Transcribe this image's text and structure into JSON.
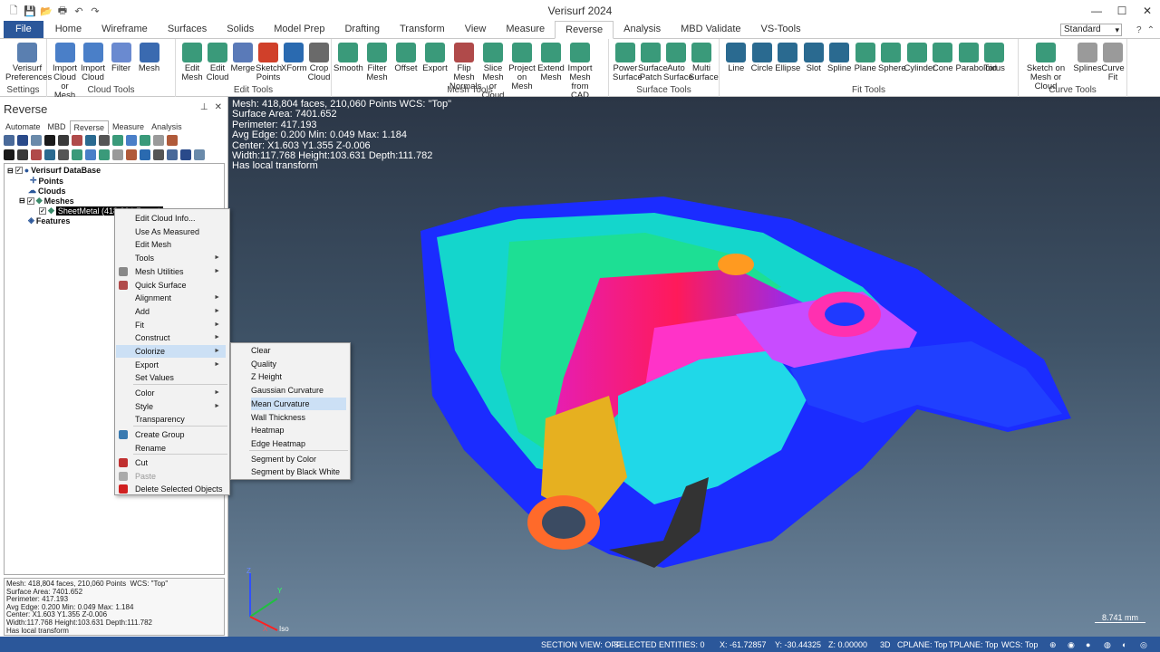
{
  "window": {
    "title": "Verisurf 2024"
  },
  "ribbon_tabs": [
    "File",
    "Home",
    "Wireframe",
    "Surfaces",
    "Solids",
    "Model Prep",
    "Drafting",
    "Transform",
    "View",
    "Measure",
    "Reverse",
    "Analysis",
    "MBD Validate",
    "VS-Tools"
  ],
  "active_tab": "Reverse",
  "style_select": "Standard",
  "groups": {
    "settings": {
      "label": "Settings",
      "buttons": [
        "Verisurf\nPreferences"
      ]
    },
    "cloud": {
      "label": "Cloud Tools",
      "buttons": [
        "Import Cloud\nor Mesh",
        "Import\nCloud",
        "Filter",
        "Mesh"
      ]
    },
    "edit": {
      "label": "Edit Tools",
      "buttons": [
        "Edit\nMesh",
        "Edit\nCloud",
        "Merge",
        "Sketch\nPoints",
        "XForm",
        "Crop\nCloud"
      ]
    },
    "mesh": {
      "label": "Mesh Tools",
      "buttons": [
        "Smooth",
        "Filter\nMesh",
        "Offset",
        "Export",
        "Flip Mesh\nNormals",
        "Slice Mesh\nor Cloud",
        "Project\non Mesh",
        "Extend\nMesh",
        "Import Mesh\nfrom CAD"
      ]
    },
    "surface": {
      "label": "Surface Tools",
      "buttons": [
        "Power\nSurface",
        "Surface\nPatch",
        "Auto\nSurface",
        "Multi\nSurface"
      ]
    },
    "fit": {
      "label": "Fit Tools",
      "buttons": [
        "Line",
        "Circle",
        "Ellipse",
        "Slot",
        "Spline",
        "Plane",
        "Sphere",
        "Cylinder",
        "Cone",
        "Paraboloid",
        "Torus"
      ]
    },
    "curve": {
      "label": "Curve Tools",
      "buttons": [
        "Sketch on\nMesh or Cloud",
        "Splines",
        "Curve\nFit"
      ]
    }
  },
  "panel": {
    "title": "Reverse",
    "tabs": [
      "Automate",
      "MBD",
      "Reverse",
      "Measure",
      "Analysis"
    ],
    "active_tab": "Reverse",
    "tree": {
      "root": "Verisurf DataBase",
      "points": "Points",
      "clouds": "Clouds",
      "meshes": "Meshes",
      "mesh_item": "SheetMetal (418,804 Faces)",
      "features": "Features"
    },
    "info": "Mesh: 418,804 faces, 210,060 Points  WCS: \"Top\"\nSurface Area: 7401.652\nPerimeter: 417.193\nAvg Edge: 0.200 Min: 0.049 Max: 1.184\nCenter: X1.603 Y1.355 Z-0.006\nWidth:117.768 Height:103.631 Depth:111.782\nHas local transform"
  },
  "viewport": {
    "info_lines": [
      "Mesh: 418,804 faces, 210,060 Points  WCS: \"Top\"",
      "Surface Area: 7401.652",
      "Perimeter: 417.193",
      "Avg Edge: 0.200 Min: 0.049 Max: 1.184",
      "Center: X1.603 Y1.355 Z-0.006",
      "Width:117.768 Height:103.631 Depth:111.782",
      "Has local transform"
    ],
    "scale_label": "8.741 mm",
    "axis_labels": {
      "x": "X",
      "y": "Y",
      "z": "Z",
      "iso": "Iso"
    }
  },
  "context_menu": {
    "items": [
      {
        "label": "Edit Cloud Info...",
        "submenu": false
      },
      {
        "label": "Use As Measured",
        "submenu": false
      },
      {
        "label": "Edit Mesh",
        "submenu": false
      },
      {
        "label": "Tools",
        "submenu": true
      },
      {
        "label": "Mesh Utilities",
        "submenu": true
      },
      {
        "label": "Quick Surface",
        "submenu": false
      },
      {
        "label": "Alignment",
        "submenu": true
      },
      {
        "label": "Add",
        "submenu": true
      },
      {
        "label": "Fit",
        "submenu": true
      },
      {
        "label": "Construct",
        "submenu": true
      },
      {
        "label": "Colorize",
        "submenu": true
      },
      {
        "label": "Export",
        "submenu": true
      },
      {
        "label": "Set Values",
        "submenu": false
      },
      {
        "label": "Color",
        "submenu": true
      },
      {
        "label": "Style",
        "submenu": true
      },
      {
        "label": "Transparency",
        "submenu": false
      },
      {
        "label": "Create Group",
        "submenu": false
      },
      {
        "label": "Rename",
        "submenu": false
      },
      {
        "label": "Cut",
        "submenu": false
      },
      {
        "label": "Paste",
        "submenu": false
      },
      {
        "label": "Delete Selected Objects",
        "submenu": false
      }
    ],
    "highlighted": "Colorize"
  },
  "colorize_submenu": {
    "items": [
      "Clear",
      "Quality",
      "Z Height",
      "Gaussian Curvature",
      "Mean Curvature",
      "Wall Thickness",
      "Heatmap",
      "Edge Heatmap",
      "Segment by Color",
      "Segment by Black  White"
    ],
    "highlighted": "Mean Curvature"
  },
  "status": {
    "section_view": "SECTION VIEW: OFF",
    "selected": "SELECTED ENTITIES: 0",
    "x": "X:   -61.72857",
    "y": "Y:   -30.44325",
    "z": "Z:   0.00000",
    "mode": "3D",
    "cplane": "CPLANE: Top",
    "tplane": "TPLANE: Top",
    "wcs": "WCS: Top"
  },
  "colors": {
    "accent": "#2b579a",
    "highlight": "#cce0f5"
  }
}
